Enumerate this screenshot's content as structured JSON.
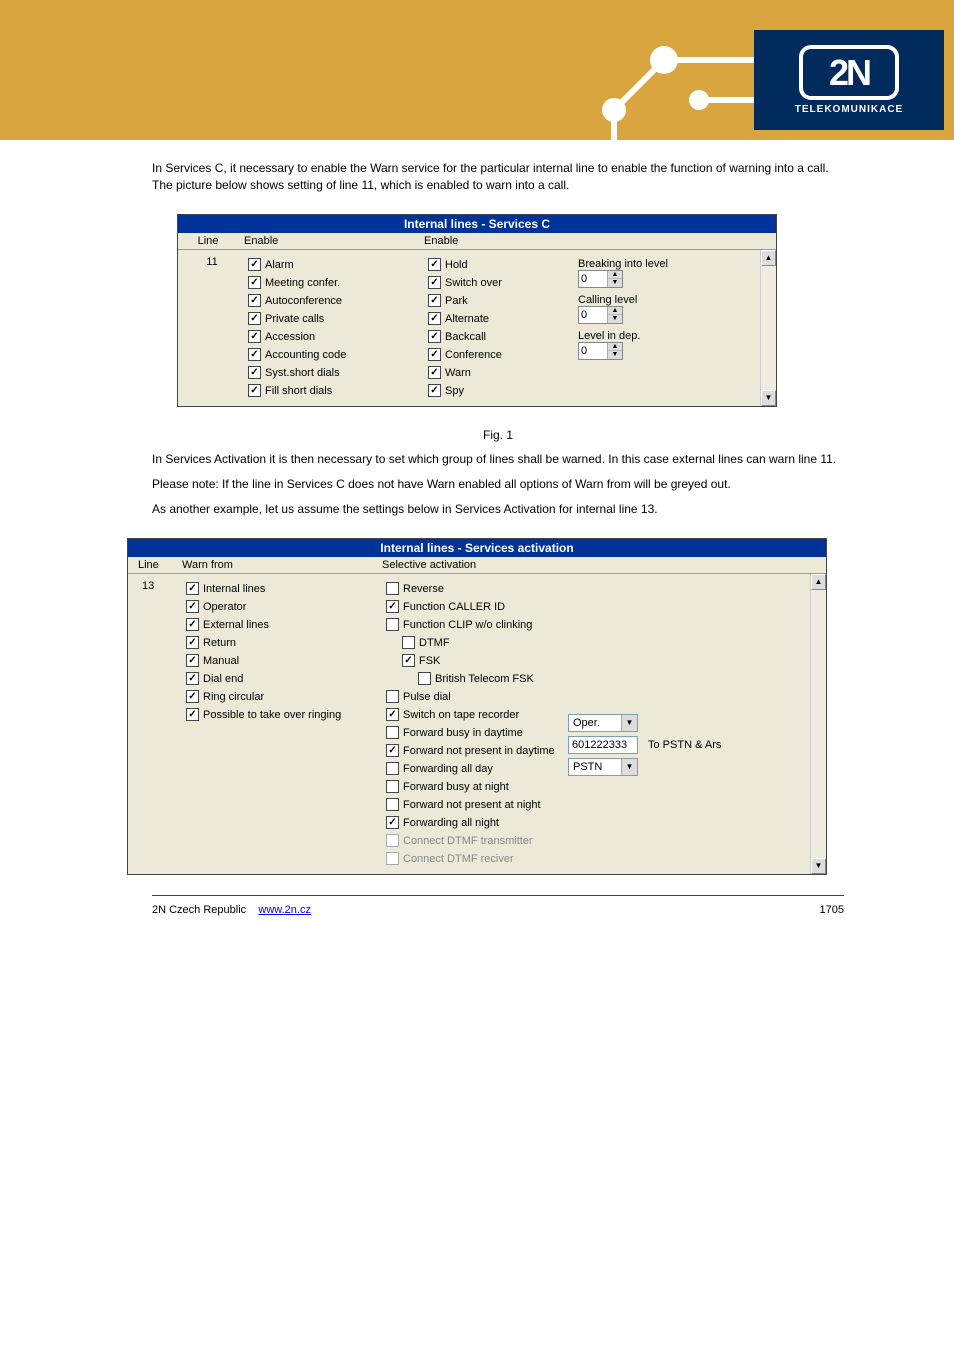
{
  "logo": {
    "text": "2N",
    "sub": "TELEKOMUNIKACE"
  },
  "intro": {
    "p1": "In Services C, it necessary to enable the Warn service for the particular internal line to enable the function of warning into a call. The picture below shows setting of line 11, which is enabled to warn into a call.",
    "fig1": "Fig. 1",
    "p2": "In Services Activation it is then necessary to set which group of lines shall be warned. In this case external lines can warn line 11.",
    "p3": "Please note: If the line in Services C does not have Warn enabled all options of Warn from will be greyed out.",
    "p4": "As another example, let us assume the settings below in Services Activation for internal line 13."
  },
  "panel1": {
    "title": "Internal lines - Services C",
    "head": {
      "line": "Line",
      "e1": "Enable",
      "e2": "Enable"
    },
    "line": "11",
    "col1": [
      {
        "c": true,
        "l": "Alarm"
      },
      {
        "c": true,
        "l": "Meeting confer."
      },
      {
        "c": true,
        "l": "Autoconference"
      },
      {
        "c": true,
        "l": "Private calls"
      },
      {
        "c": true,
        "l": "Accession"
      },
      {
        "c": true,
        "l": "Accounting code"
      },
      {
        "c": true,
        "l": "Syst.short dials"
      },
      {
        "c": true,
        "l": "Fill short dials"
      }
    ],
    "col2": [
      {
        "c": true,
        "l": "Hold"
      },
      {
        "c": true,
        "l": "Switch over"
      },
      {
        "c": true,
        "l": "Park"
      },
      {
        "c": true,
        "l": "Alternate"
      },
      {
        "c": true,
        "l": "Backcall"
      },
      {
        "c": true,
        "l": "Conference"
      },
      {
        "c": true,
        "l": "Warn"
      },
      {
        "c": true,
        "l": "Spy"
      }
    ],
    "spins": [
      {
        "l": "Breaking into level",
        "v": "0"
      },
      {
        "l": "Calling level",
        "v": "0"
      },
      {
        "l": "Level in dep.",
        "v": "0"
      }
    ]
  },
  "panel2": {
    "title": "Internal lines - Services activation",
    "head": {
      "line": "Line",
      "warn": "Warn from",
      "sel": "Selective activation"
    },
    "line": "13",
    "warn": [
      {
        "c": true,
        "l": "Internal lines"
      },
      {
        "c": true,
        "l": "Operator"
      },
      {
        "c": true,
        "l": "External lines"
      },
      {
        "c": true,
        "l": "Return"
      },
      {
        "c": true,
        "l": "Manual"
      },
      {
        "c": true,
        "l": "Dial end"
      },
      {
        "c": true,
        "l": "Ring circular"
      },
      {
        "c": true,
        "l": "Possible to take over ringing"
      }
    ],
    "sel": [
      {
        "c": false,
        "l": "Reverse",
        "i": 0
      },
      {
        "c": true,
        "l": "Function CALLER ID",
        "i": 0
      },
      {
        "c": false,
        "l": "Function CLIP w/o clinking",
        "i": 0
      },
      {
        "c": false,
        "l": "DTMF",
        "i": 1
      },
      {
        "c": true,
        "l": "FSK",
        "i": 1
      },
      {
        "c": false,
        "l": "British Telecom FSK",
        "i": 2
      },
      {
        "c": false,
        "l": "Pulse dial",
        "i": 0
      },
      {
        "c": true,
        "l": "Switch on tape recorder",
        "i": 0
      },
      {
        "c": false,
        "l": "Forward busy in daytime",
        "i": 0
      },
      {
        "c": true,
        "l": "Forward not present in daytime",
        "i": 0
      },
      {
        "c": false,
        "l": "Forwarding all day",
        "i": 0
      },
      {
        "c": false,
        "l": "Forward busy at night",
        "i": 0
      },
      {
        "c": false,
        "l": "Forward not present at night",
        "i": 0
      },
      {
        "c": true,
        "l": "Forwarding all night",
        "i": 0
      },
      {
        "c": false,
        "l": "Connect DTMF transmitter",
        "i": 0,
        "d": true
      },
      {
        "c": false,
        "l": "Connect DTMF reciver",
        "i": 0,
        "d": true
      }
    ],
    "dd1": "Oper.",
    "txt": "601222333",
    "btn": "To PSTN & Ars",
    "dd2": "PSTN"
  },
  "footer": {
    "left": "2N Czech Republic",
    "link": "www.2n.cz",
    "right": "1705"
  }
}
